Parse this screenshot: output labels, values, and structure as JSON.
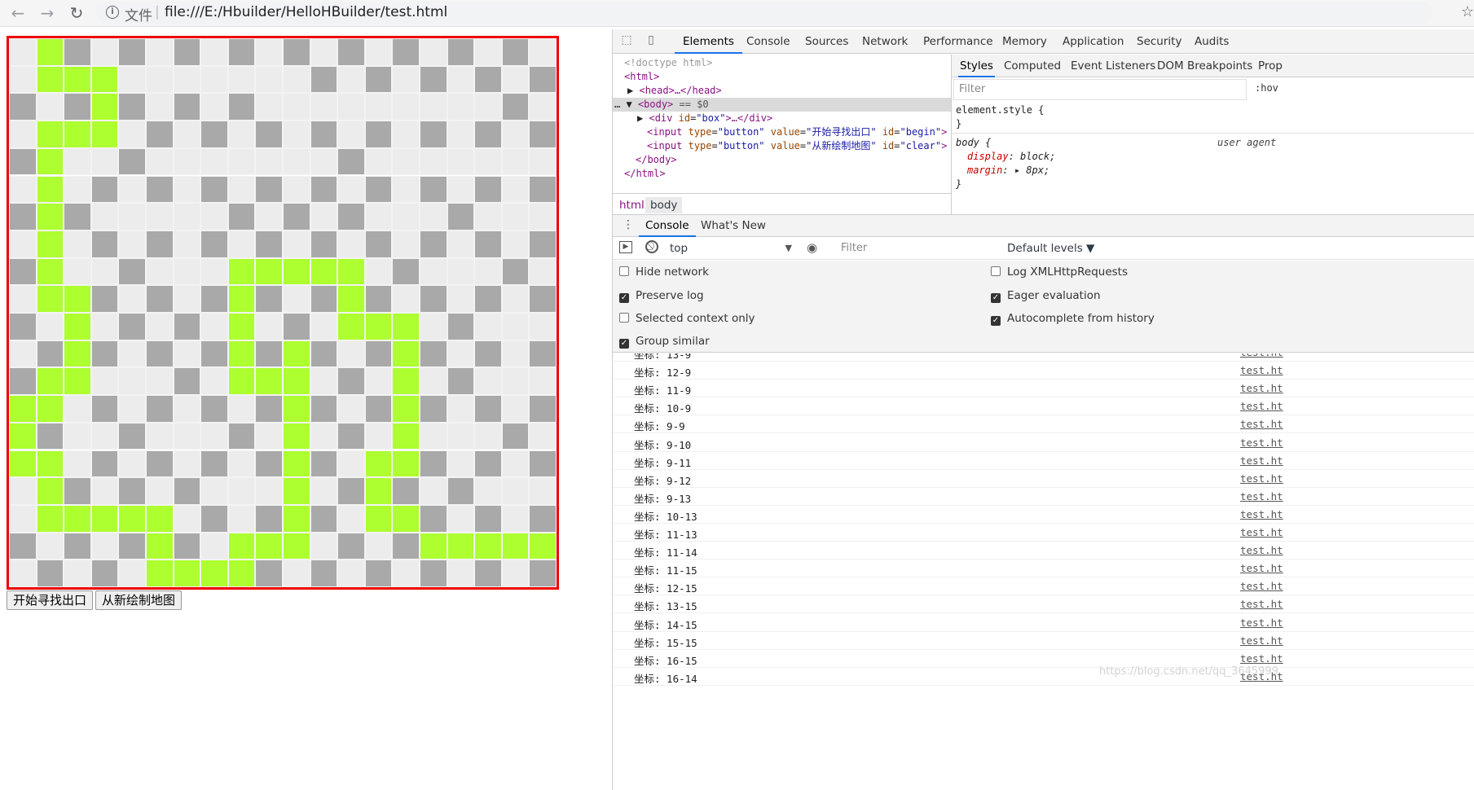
{
  "browser": {
    "scheme_label": "文件",
    "url": "file:///E:/Hbuilder/HelloHBuilder/test.html"
  },
  "maze": {
    "rows": [
      [
        0,
        2,
        1,
        0,
        1,
        0,
        1,
        0,
        1,
        0,
        1,
        0,
        1,
        0,
        1,
        0,
        1,
        0,
        1,
        0
      ],
      [
        0,
        2,
        2,
        2,
        0,
        0,
        0,
        0,
        0,
        0,
        0,
        1,
        0,
        1,
        0,
        1,
        0,
        1,
        0,
        1
      ],
      [
        1,
        0,
        1,
        2,
        1,
        0,
        1,
        0,
        1,
        0,
        0,
        0,
        0,
        0,
        0,
        0,
        0,
        0,
        1,
        0
      ],
      [
        0,
        2,
        2,
        2,
        0,
        1,
        0,
        1,
        0,
        1,
        0,
        1,
        0,
        1,
        0,
        1,
        0,
        1,
        0,
        1
      ],
      [
        1,
        2,
        0,
        0,
        1,
        0,
        0,
        0,
        0,
        0,
        0,
        0,
        1,
        0,
        0,
        0,
        0,
        0,
        0,
        0
      ],
      [
        0,
        2,
        0,
        1,
        0,
        1,
        0,
        1,
        0,
        1,
        0,
        1,
        0,
        1,
        0,
        1,
        0,
        1,
        0,
        1
      ],
      [
        1,
        2,
        1,
        0,
        0,
        0,
        0,
        0,
        1,
        0,
        1,
        0,
        1,
        0,
        0,
        0,
        1,
        0,
        0,
        0
      ],
      [
        0,
        2,
        0,
        1,
        0,
        1,
        0,
        1,
        0,
        1,
        0,
        1,
        0,
        1,
        0,
        1,
        0,
        1,
        0,
        1
      ],
      [
        1,
        2,
        0,
        0,
        1,
        0,
        0,
        0,
        2,
        2,
        2,
        2,
        2,
        0,
        1,
        0,
        0,
        0,
        1,
        0
      ],
      [
        0,
        2,
        2,
        1,
        0,
        1,
        0,
        1,
        2,
        1,
        0,
        1,
        2,
        1,
        0,
        1,
        0,
        1,
        0,
        1
      ],
      [
        1,
        0,
        2,
        0,
        1,
        0,
        1,
        0,
        2,
        0,
        1,
        0,
        2,
        2,
        2,
        0,
        1,
        0,
        0,
        0
      ],
      [
        0,
        1,
        2,
        1,
        0,
        1,
        0,
        1,
        2,
        1,
        2,
        1,
        0,
        1,
        2,
        1,
        0,
        1,
        0,
        1
      ],
      [
        1,
        2,
        2,
        0,
        0,
        0,
        1,
        0,
        2,
        2,
        2,
        0,
        1,
        0,
        2,
        0,
        1,
        0,
        0,
        0
      ],
      [
        2,
        2,
        0,
        1,
        0,
        1,
        0,
        1,
        0,
        1,
        2,
        1,
        0,
        1,
        2,
        1,
        0,
        1,
        0,
        1
      ],
      [
        2,
        1,
        0,
        0,
        1,
        0,
        0,
        0,
        1,
        0,
        2,
        0,
        1,
        0,
        2,
        0,
        0,
        0,
        1,
        0
      ],
      [
        2,
        2,
        0,
        1,
        0,
        1,
        0,
        1,
        0,
        1,
        2,
        1,
        0,
        2,
        2,
        1,
        0,
        1,
        0,
        1
      ],
      [
        0,
        2,
        1,
        0,
        1,
        0,
        1,
        0,
        0,
        0,
        2,
        0,
        1,
        2,
        1,
        0,
        1,
        0,
        0,
        0
      ],
      [
        0,
        2,
        2,
        2,
        2,
        2,
        0,
        1,
        0,
        1,
        2,
        1,
        0,
        2,
        2,
        1,
        0,
        1,
        0,
        1
      ],
      [
        1,
        0,
        1,
        0,
        1,
        2,
        1,
        0,
        2,
        2,
        2,
        0,
        1,
        0,
        1,
        2,
        2,
        2,
        2,
        2
      ],
      [
        0,
        1,
        0,
        1,
        0,
        2,
        2,
        2,
        2,
        1,
        0,
        1,
        0,
        1,
        0,
        1,
        0,
        1,
        0,
        1
      ]
    ],
    "colors": {
      "wall": "#a9a9a9",
      "path": "#ececec",
      "route": "#adff2f",
      "border": "#ee0000"
    }
  },
  "buttons": {
    "begin": "开始寻找出口",
    "clear": "从新绘制地图"
  },
  "devtools": {
    "tabs": [
      "Elements",
      "Console",
      "Sources",
      "Network",
      "Performance",
      "Memory",
      "Application",
      "Security",
      "Audits"
    ],
    "dom": {
      "doctype": "<!doctype html>",
      "html_open": "<html>",
      "head": "<head>…</head>",
      "body_open": "<body>",
      "body_marker": "== $0",
      "div_tag": "<div",
      "div_attr": "id",
      "div_val": "\"box\"",
      "div_rest": ">…</div>",
      "input1_tag": "<input",
      "input1_type_attr": "type",
      "input1_type_val": "\"button\"",
      "input1_value_attr": "value",
      "input1_value_val": "\"开始寻找出口\"",
      "input1_id_attr": "id",
      "input1_id_val": "\"begin\"",
      "input1_end": ">",
      "input2_tag": "<input",
      "input2_type_attr": "type",
      "input2_type_val": "\"button\"",
      "input2_value_attr": "value",
      "input2_value_val": "\"从新绘制地图\"",
      "input2_id_attr": "id",
      "input2_id_val": "\"clear\"",
      "input2_end": ">",
      "body_close": "</body>",
      "html_close": "</html>"
    },
    "breadcrumbs": [
      "html",
      "body"
    ],
    "styles_tabs": [
      "Styles",
      "Computed",
      "Event Listeners",
      "DOM Breakpoints",
      "Prop"
    ],
    "styles_filter_placeholder": "Filter",
    "hov": ":hov",
    "element_style_open": "element.style {",
    "element_style_close": "}",
    "body_rule_selector": "body {",
    "body_rule_source": "user agent",
    "body_rule_prop1": "display",
    "body_rule_val1": "block;",
    "body_rule_prop2": "margin",
    "body_rule_val2": "8px;",
    "body_rule_close": "}",
    "console_tabs": [
      "Console",
      "What's New"
    ],
    "context": "top",
    "console_filter_placeholder": "Filter",
    "levels": "Default levels ▼",
    "settings_left": [
      {
        "label": "Hide network",
        "checked": false
      },
      {
        "label": "Preserve log",
        "checked": true
      },
      {
        "label": "Selected context only",
        "checked": false
      },
      {
        "label": "Group similar",
        "checked": true
      }
    ],
    "settings_right": [
      {
        "label": "Log XMLHttpRequests",
        "checked": false
      },
      {
        "label": "Eager evaluation",
        "checked": true
      },
      {
        "label": "Autocomplete from history",
        "checked": true
      }
    ],
    "log_source": "test.ht",
    "log": [
      "坐标: 13-9",
      "坐标: 12-9",
      "坐标: 11-9",
      "坐标: 10-9",
      "坐标: 9-9",
      "坐标: 9-10",
      "坐标: 9-11",
      "坐标: 9-12",
      "坐标: 9-13",
      "坐标: 10-13",
      "坐标: 11-13",
      "坐标: 11-14",
      "坐标: 11-15",
      "坐标: 12-15",
      "坐标: 13-15",
      "坐标: 14-15",
      "坐标: 15-15",
      "坐标: 16-15",
      "坐标: 16-14"
    ],
    "watermark": "https://blog.csdn.net/qq_3645999"
  }
}
